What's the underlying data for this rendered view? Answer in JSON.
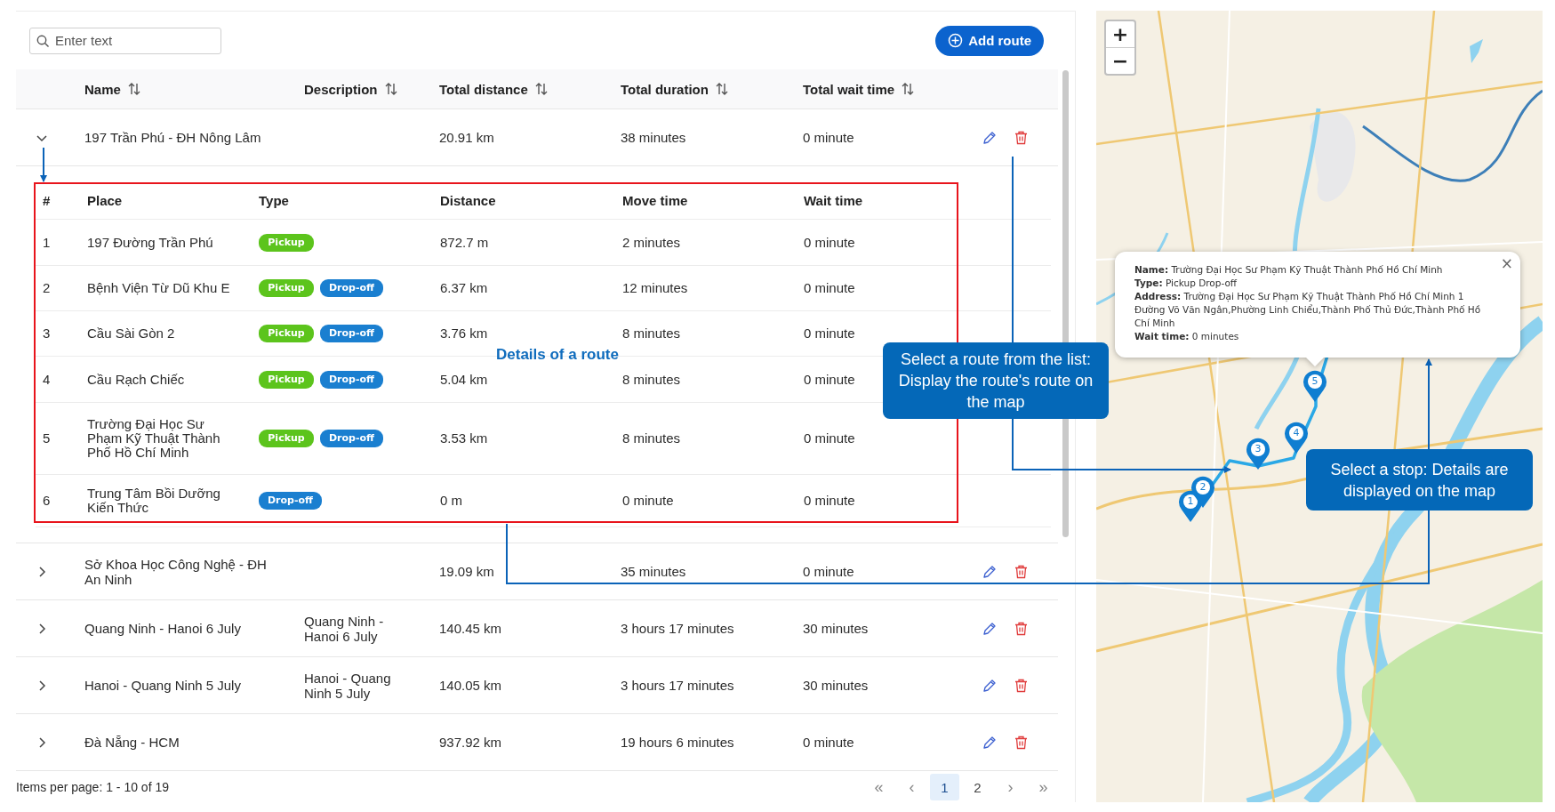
{
  "search": {
    "placeholder": "Enter text"
  },
  "add_button": {
    "label": "Add route"
  },
  "columns": [
    {
      "label": "Name"
    },
    {
      "label": "Description"
    },
    {
      "label": "Total distance"
    },
    {
      "label": "Total duration"
    },
    {
      "label": "Total wait time"
    }
  ],
  "routes": [
    {
      "name": "197 Trần Phú - ĐH Nông Lâm",
      "total_distance": "20.91 km",
      "total_duration": "38 minutes",
      "total_wait_time": "0 minute",
      "expanded": true,
      "details": {
        "columns": [
          "#",
          "Place",
          "Type",
          "Distance",
          "Move time",
          "Wait time"
        ],
        "stops": [
          {
            "number": "1",
            "place": "197 Đường Trần Phú",
            "types": [
              {
                "kind": "pickup",
                "label": "Pickup"
              }
            ],
            "distance": "872.7 m",
            "move_time": "2 minutes",
            "wait_time": "0 minute"
          },
          {
            "number": "2",
            "place": "Bệnh Viện Từ Dũ Khu E",
            "types": [
              {
                "kind": "pickup",
                "label": "Pickup"
              },
              {
                "kind": "dropoff",
                "label": "Drop-off"
              }
            ],
            "distance": "6.37 km",
            "move_time": "12 minutes",
            "wait_time": "0 minute"
          },
          {
            "number": "3",
            "place": "Cầu Sài Gòn 2",
            "types": [
              {
                "kind": "pickup",
                "label": "Pickup"
              },
              {
                "kind": "dropoff",
                "label": "Drop-off"
              }
            ],
            "distance": "3.76 km",
            "move_time": "8 minutes",
            "wait_time": "0 minute"
          },
          {
            "number": "4",
            "place": "Cầu Rạch Chiếc",
            "types": [
              {
                "kind": "pickup",
                "label": "Pickup"
              },
              {
                "kind": "dropoff",
                "label": "Drop-off"
              }
            ],
            "distance": "5.04 km",
            "move_time": "8 minutes",
            "wait_time": "0 minute"
          },
          {
            "number": "5",
            "place": "Trường Đại Học Sư Phạm Kỹ Thuật Thành Phố Hồ Chí Minh",
            "types": [
              {
                "kind": "pickup",
                "label": "Pickup"
              },
              {
                "kind": "dropoff",
                "label": "Drop-off"
              }
            ],
            "distance": "3.53 km",
            "move_time": "8 minutes",
            "wait_time": "0 minute"
          },
          {
            "number": "6",
            "place": "Trung Tâm Bồi Dưỡng Kiến Thức",
            "types": [
              {
                "kind": "dropoff",
                "label": "Drop-off"
              }
            ],
            "distance": "0 m",
            "move_time": "0 minute",
            "wait_time": "0 minute"
          }
        ]
      }
    },
    {
      "name": "Sở Khoa Học Công Nghệ - ĐH An Ninh",
      "total_distance": "19.09 km",
      "total_duration": "35 minutes",
      "total_wait_time": "0 minute",
      "expanded": false
    },
    {
      "name": "Quang Ninh - Hanoi 6 July",
      "description": "Quang Ninh - Hanoi 6 July",
      "total_distance": "140.45 km",
      "total_duration": "3 hours 17 minutes",
      "total_wait_time": "30 minutes",
      "expanded": false
    },
    {
      "name": "Hanoi - Quang Ninh 5 July",
      "description": "Hanoi - Quang Ninh 5 July",
      "total_distance": "140.05 km",
      "total_duration": "3 hours 17 minutes",
      "total_wait_time": "30 minutes",
      "expanded": false
    },
    {
      "name": "Đà Nẵng - HCM",
      "total_distance": "937.92 km",
      "total_duration": "19 hours 6 minutes",
      "total_wait_time": "0 minute",
      "expanded": false
    }
  ],
  "pagination": {
    "summary": "Items per page: 1 - 10 of 19",
    "first": "«",
    "prev": "‹",
    "pages": [
      {
        "label": "1",
        "selected": true
      },
      {
        "label": "2",
        "selected": false
      }
    ],
    "next": "›",
    "last": "»"
  },
  "map": {
    "zoom_in": "+",
    "zoom_out": "−",
    "markers": [
      {
        "label": "1"
      },
      {
        "label": "2"
      },
      {
        "label": "3"
      },
      {
        "label": "4"
      },
      {
        "label": "5"
      }
    ],
    "popup": {
      "close": "×",
      "lines": [
        "**Name:** Trường Đại Học Sư Phạm Kỹ Thuật Thành Phố Hồ Chí Minh",
        "**Type:** Pickup Drop-off",
        "**Address:** Trường Đại Học Sư Phạm Kỹ Thuật Thành Phố Hồ Chí Minh 1 Đường Võ Văn Ngân,Phường Linh Chiểu,Thành Phố Thủ Đức,Thành Phố Hồ Chí Minh",
        "**Wait time:** 0 minutes"
      ]
    }
  },
  "annotations": {
    "details_label": "Details of a route",
    "callouts": [
      {
        "text": "Select a route from the list: Display the route's route on the map"
      },
      {
        "text": "Select a stop: Details are displayed on the map"
      }
    ]
  }
}
